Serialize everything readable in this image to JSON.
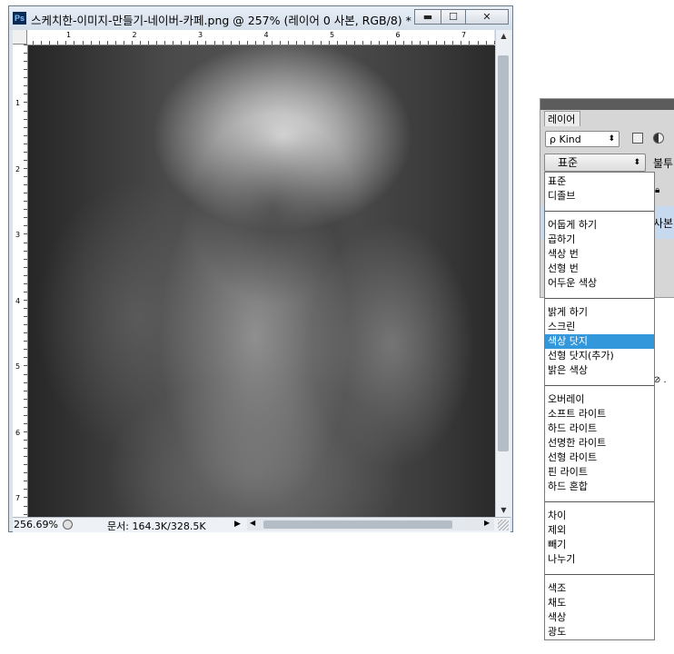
{
  "document_window": {
    "ps_logo": "Ps",
    "title": "스케치한-이미지-만들기-네이버-카페.png @ 257% (레이어 0 사본, RGB/8) *",
    "buttons": {
      "minimize": "▬",
      "maximize": "☐",
      "close": "✕"
    },
    "ruler_top_labels": [
      "1",
      "2",
      "3",
      "4",
      "5",
      "6",
      "7"
    ],
    "ruler_left_labels": [
      "1",
      "2",
      "3",
      "4",
      "5",
      "6",
      "7"
    ],
    "status": {
      "zoom": "256.69%",
      "doc_info": "문서: 164.3K/328.5K"
    }
  },
  "layers_panel": {
    "tab_label": "레이어",
    "kind_filter": "ρ Kind",
    "blend_mode_selected": "표준",
    "opacity_label_partial": "불투",
    "layer_name_partial": "사본",
    "bottom_partial": "⊘ ."
  },
  "blend_menu": {
    "groups": [
      [
        "표준",
        "디졸브"
      ],
      [
        "어둡게 하기",
        "곱하기",
        "색상 번",
        "선형 번",
        "어두운 색상"
      ],
      [
        "밝게 하기",
        "스크린",
        "색상 닷지",
        "선형 닷지(추가)",
        "밝은 색상"
      ],
      [
        "오버레이",
        "소프트 라이트",
        "하드 라이트",
        "선명한 라이트",
        "선형 라이트",
        "핀 라이트",
        "하드 혼합"
      ],
      [
        "차이",
        "제외",
        "빼기",
        "나누기"
      ],
      [
        "색조",
        "채도",
        "색상",
        "광도"
      ]
    ],
    "highlighted": "색상 닷지",
    "highlight_color": "#3398db"
  }
}
